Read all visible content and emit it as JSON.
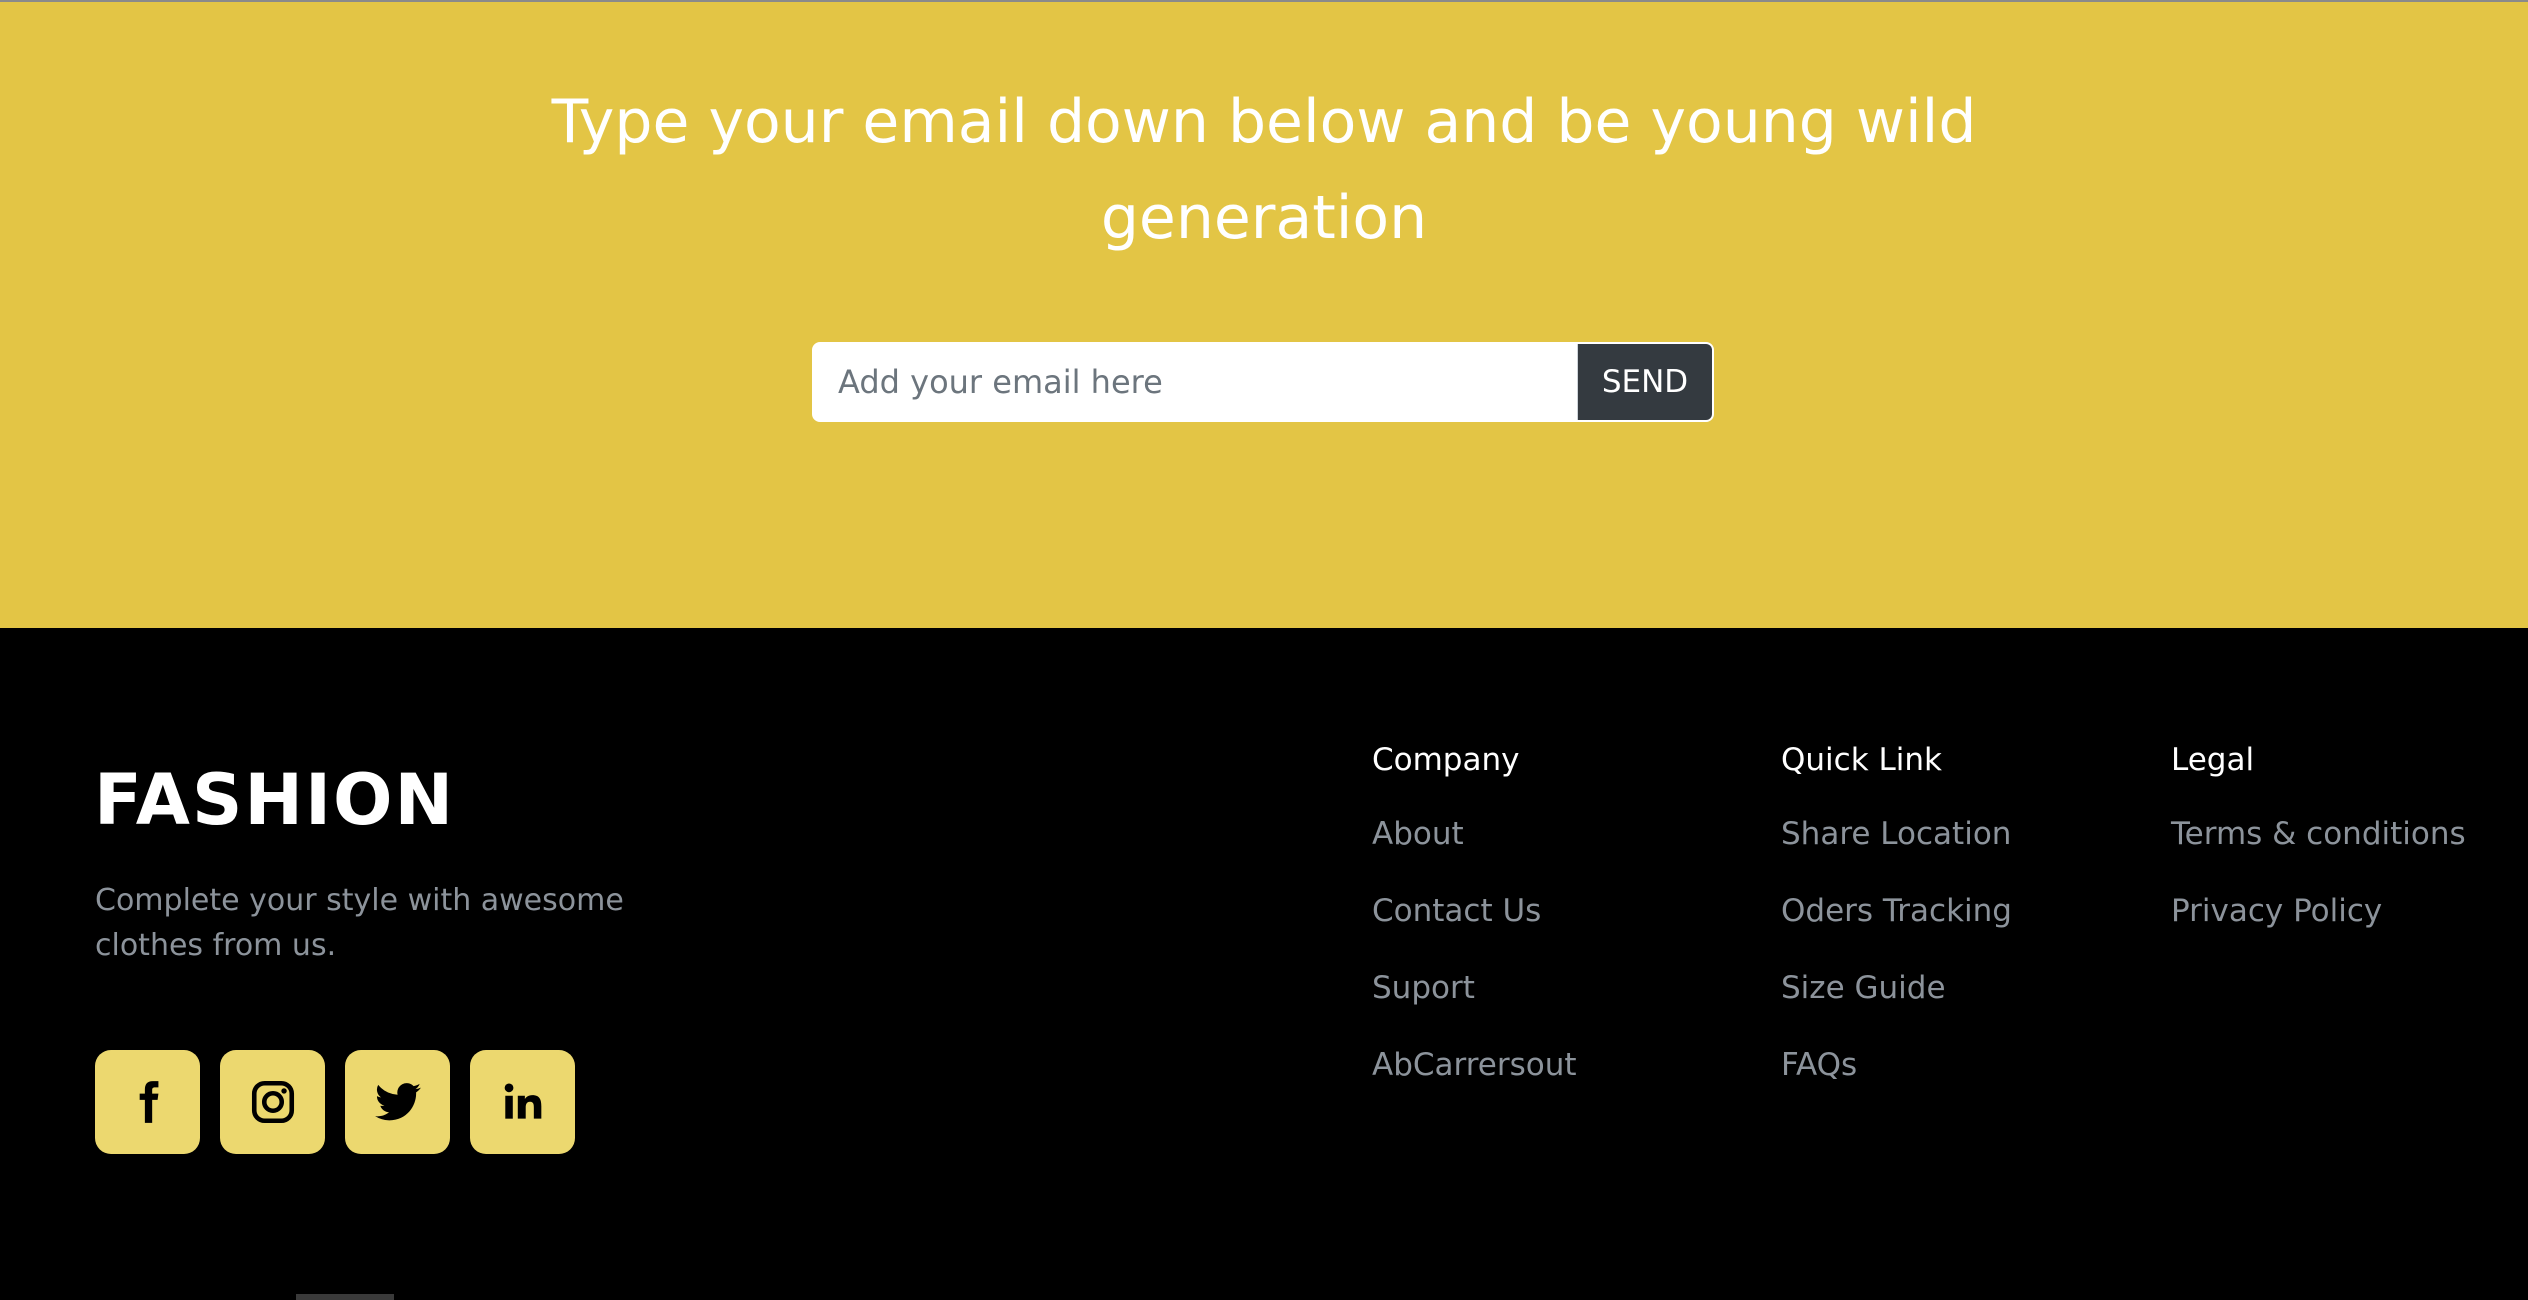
{
  "newsletter": {
    "heading": "Type your email down below and be young wild generation",
    "email_placeholder": "Add your email here",
    "send_label": "SEND"
  },
  "footer": {
    "brand": "FASHION",
    "tagline": "Complete your style with awesome clothes from us.",
    "social": [
      {
        "icon": "facebook-icon"
      },
      {
        "icon": "instagram-icon"
      },
      {
        "icon": "twitter-icon"
      },
      {
        "icon": "linkedin-icon"
      }
    ],
    "columns": [
      {
        "heading": "Company",
        "links": [
          "About",
          "Contact Us",
          "Suport",
          "AbCarrersout"
        ]
      },
      {
        "heading": "Quick Link",
        "links": [
          "Share Location",
          "Oders Tracking",
          "Size Guide",
          "FAQs"
        ]
      },
      {
        "heading": "Legal",
        "links": [
          "Terms & conditions",
          "Privacy Policy"
        ]
      }
    ]
  },
  "colors": {
    "newsletter_bg": "#e3c545",
    "footer_bg": "#000000",
    "social_button_bg": "#ecd86f",
    "send_button_bg": "#343a40",
    "muted_link": "#8c939b"
  }
}
